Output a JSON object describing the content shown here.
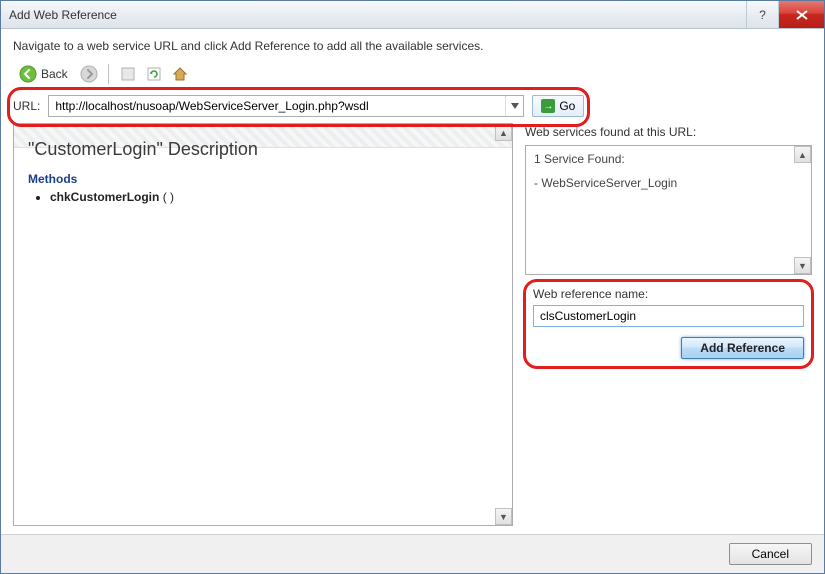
{
  "window": {
    "title": "Add Web Reference"
  },
  "instruction": "Navigate to a web service URL and click Add Reference to add all the available services.",
  "toolbar": {
    "back_label": "Back"
  },
  "url": {
    "label": "URL:",
    "value": "http://localhost/nusoap/WebServiceServer_Login.php?wsdl",
    "go_label": "Go"
  },
  "preview": {
    "heading": "\"CustomerLogin\" Description",
    "methods_heading": "Methods",
    "method_name": "chkCustomerLogin",
    "method_params": "( )"
  },
  "services": {
    "found_label": "Web services found at this URL:",
    "summary": "1 Service Found:",
    "service_name": "- WebServiceServer_Login"
  },
  "refname": {
    "label": "Web reference name:",
    "value": "clsCustomerLogin",
    "add_label": "Add Reference"
  },
  "footer": {
    "cancel_label": "Cancel"
  }
}
